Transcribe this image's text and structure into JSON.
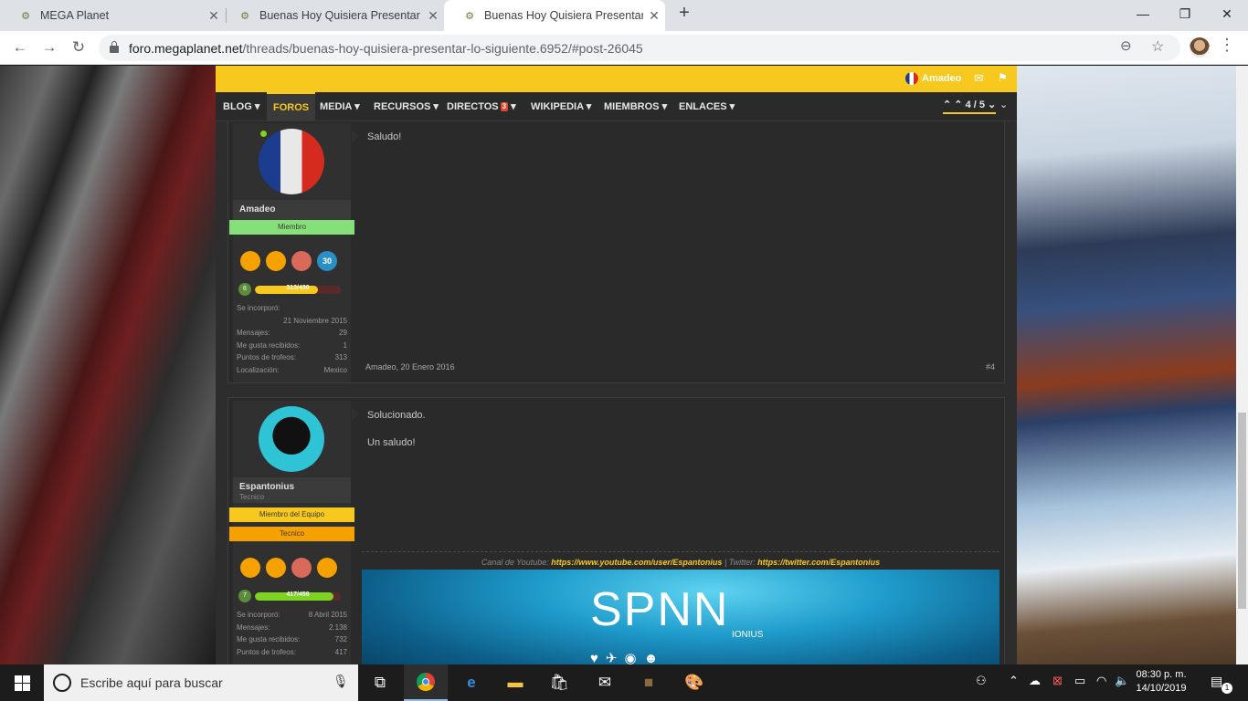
{
  "browser": {
    "tabs": [
      {
        "title": "MEGA Planet",
        "active": false
      },
      {
        "title": "Buenas Hoy Quisiera Presentar Lo",
        "active": false
      },
      {
        "title": "Buenas Hoy Quisiera Presentar Lo",
        "active": true
      }
    ],
    "new_tab": "+",
    "url_host": "foro.megaplanet.net",
    "url_path": "/threads/buenas-hoy-quisiera-presentar-lo-siguiente.6952/#post-26045",
    "window_controls": {
      "minimize": "—",
      "maximize": "❐",
      "close": "✕"
    }
  },
  "forum": {
    "user": {
      "name": "Amadeo"
    },
    "nav": [
      {
        "label": "BLOG",
        "arrow": "▾"
      },
      {
        "label": "FOROS",
        "active": true
      },
      {
        "label": "MEDIA",
        "arrow": "▾"
      },
      {
        "label": "RECURSOS",
        "arrow": "▾"
      },
      {
        "label": "DIRECTOS",
        "badge": "3",
        "arrow": "▾"
      },
      {
        "label": "WIKIPEDIA",
        "arrow": "▾"
      },
      {
        "label": "MIEMBROS",
        "arrow": "▾"
      },
      {
        "label": "ENLACES",
        "arrow": "▾"
      }
    ],
    "pagination": "4 / 5",
    "pagination_first": "⌃",
    "pagination_prev": "⌃",
    "pagination_next": "⌄",
    "pagination_last": "⌄"
  },
  "posts": [
    {
      "author": "Amadeo",
      "role": "Miembro",
      "xp": "313/430",
      "xp_fraction": 0.73,
      "level": "6",
      "trophies": [
        "",
        "",
        "",
        "30"
      ],
      "stats": [
        {
          "label": "Se incorporó:",
          "value": "21 Noviembre 2015"
        },
        {
          "label": "Mensajes:",
          "value": "29"
        },
        {
          "label": "Me gusta recibidos:",
          "value": "1"
        },
        {
          "label": "Puntos de trofeos:",
          "value": "313"
        },
        {
          "label": "Localización:",
          "value": "Mexico"
        }
      ],
      "message": [
        "Saludo!"
      ],
      "date": "Amadeo, 20 Enero 2016",
      "permalink": "#4"
    },
    {
      "author": "Espantonius",
      "title": "Tecnico",
      "roles": [
        "Miembro del Equipo",
        "Tecnico"
      ],
      "xp": "417/459",
      "xp_fraction": 0.91,
      "level": "7",
      "trophies": [
        "",
        "",
        "",
        ""
      ],
      "stats": [
        {
          "label": "Se incorporó:",
          "value": "8 Abril 2015"
        },
        {
          "label": "Mensajes:",
          "value": "2.138"
        },
        {
          "label": "Me gusta recibidos:",
          "value": "732"
        },
        {
          "label": "Puntos de trofeos:",
          "value": "417"
        }
      ],
      "message": [
        "Solucionado.",
        "Un saludo!"
      ],
      "signature": {
        "youtube_label": "Canal de Youtube:",
        "youtube_link": "https://www.youtube.com/user/Espantonius",
        "separator": "|",
        "twitter_label": "Twitter:",
        "twitter_link": "https://twitter.com/Espantonius",
        "banner_title": "SPNN",
        "banner_sub": "IONIUS"
      }
    }
  ],
  "taskbar": {
    "search_placeholder": "Escribe aquí para buscar",
    "time": "08:30 p. m.",
    "date": "14/10/2019",
    "notification_count": "1"
  },
  "colors": {
    "accent": "#f7c81e",
    "member": "#86e07a",
    "staff": "#f7c81e",
    "tecnico": "#f5a100"
  }
}
